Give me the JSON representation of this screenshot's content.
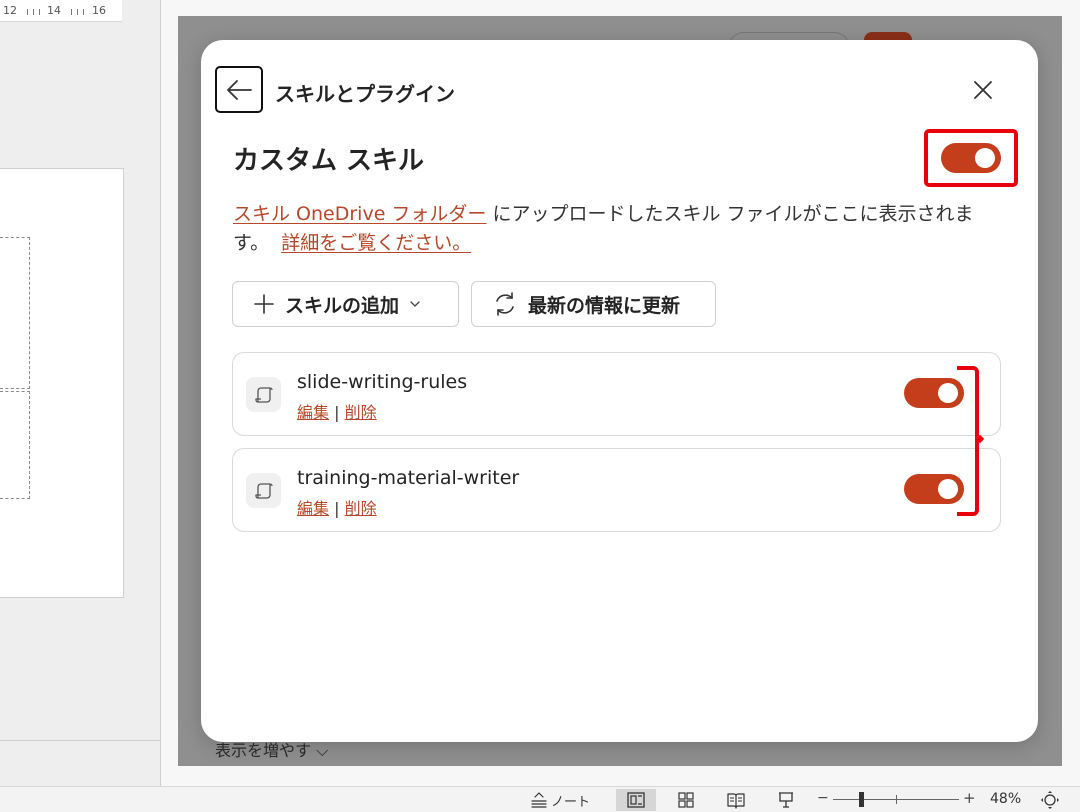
{
  "ruler": {
    "labels": [
      "12",
      "14",
      "16"
    ]
  },
  "pane": {
    "show_more": "表示を増やす ⌵"
  },
  "dialog": {
    "title": "スキルとプラグイン",
    "section_title": "カスタム スキル",
    "master_toggle": {
      "state": "on"
    },
    "description": {
      "link_folder": "スキル OneDrive フォルダー",
      "text_mid": " にアップロードしたスキル ファイルがここに表示されます。",
      "link_more": "詳細をご覧ください。"
    },
    "buttons": {
      "add_skill": "スキルの追加",
      "refresh": "最新の情報に更新"
    },
    "skills": [
      {
        "name": "slide-writing-rules",
        "edit": "編集",
        "sep": "|",
        "delete": "削除",
        "enabled": true
      },
      {
        "name": "training-material-writer",
        "edit": "編集",
        "sep": "|",
        "delete": "削除",
        "enabled": true
      }
    ]
  },
  "statusbar": {
    "notes_label": "ノート",
    "zoom_minus": "−",
    "zoom_plus": "+",
    "zoom_percent": "48%",
    "zoom_value": 48
  },
  "colors": {
    "accent": "#c43e1c",
    "link": "#b7472a",
    "highlight": "#e8000b"
  }
}
